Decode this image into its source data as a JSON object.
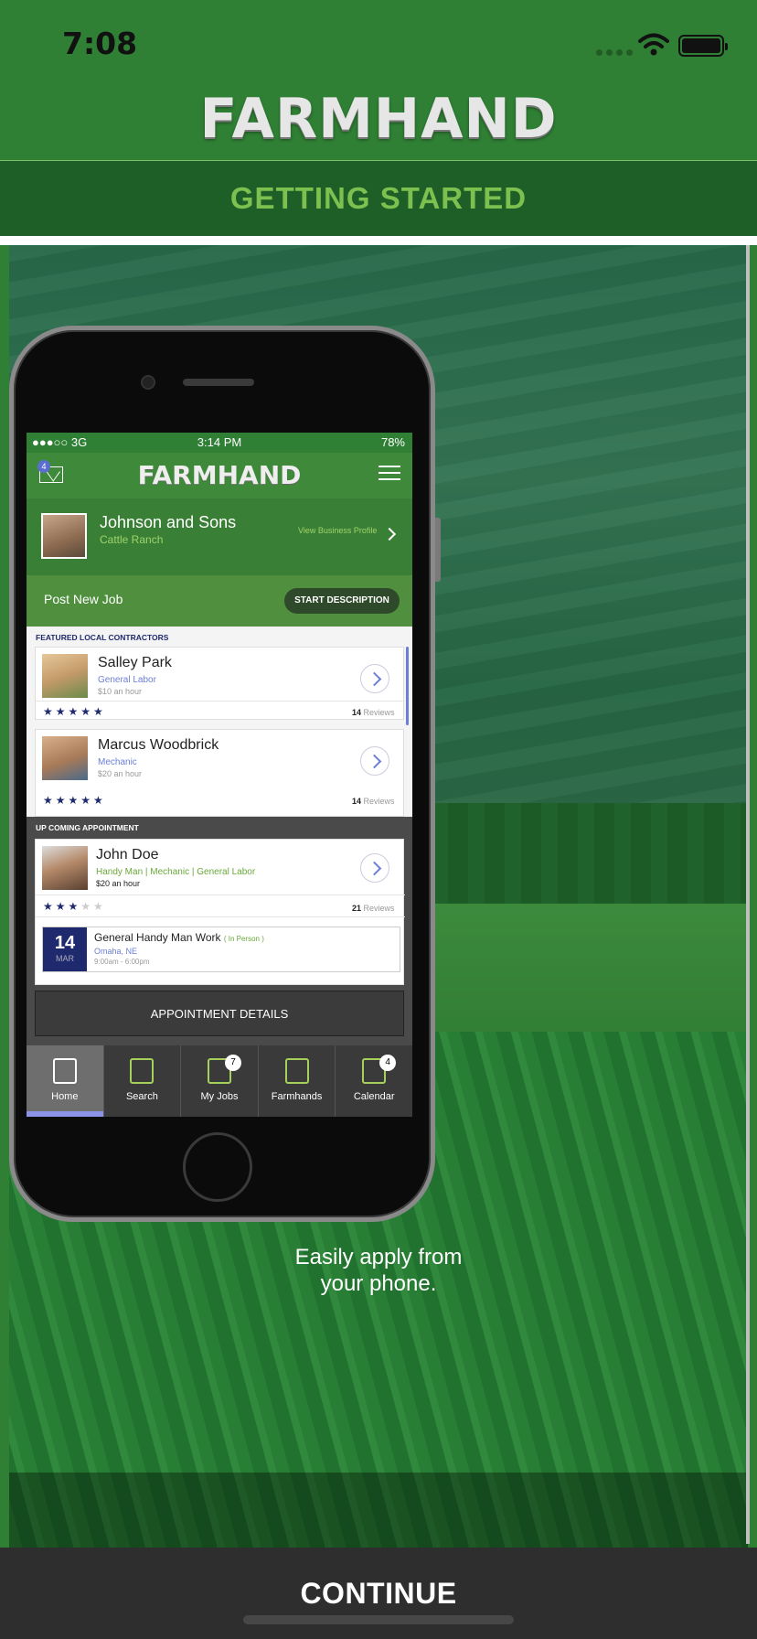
{
  "status_bar": {
    "time": "7:08"
  },
  "header": {
    "logo": "FARMHAND",
    "subtitle": "GETTING STARTED"
  },
  "slide": {
    "caption_line1": "Easily apply from",
    "caption_line2": "your phone."
  },
  "continue_label": "CONTINUE",
  "mockup": {
    "status": {
      "carrier": "●●●○○ 3G",
      "time": "3:14 PM",
      "battery": "78%"
    },
    "mail_badge": "4",
    "logo": "FARMHAND",
    "profile": {
      "name": "Johnson and Sons",
      "type": "Cattle Ranch",
      "view_link": "View Business Profile"
    },
    "post_job": {
      "label": "Post New Job",
      "button": "START DESCRIPTION"
    },
    "featured": {
      "heading": "FEATURED LOCAL CONTRACTORS",
      "contractors": [
        {
          "name": "Salley Park",
          "role": "General Labor",
          "rate": "$10 an hour",
          "stars": "★★★★★",
          "reviews_count": "14",
          "reviews_label": "Reviews"
        },
        {
          "name": "Marcus Woodbrick",
          "role": "Mechanic",
          "rate": "$20 an hour",
          "stars": "★★★★★",
          "reviews_count": "14",
          "reviews_label": "Reviews"
        }
      ]
    },
    "upcoming": {
      "heading": "UP COMING APPOINTMENT",
      "name": "John Doe",
      "roles": "Handy Man | Mechanic | General Labor",
      "rate": "$20 an hour",
      "stars_filled": "★★★",
      "stars_empty": "★★",
      "reviews_count": "21",
      "reviews_label": "Reviews",
      "date_day": "14",
      "date_month": "MAR",
      "job_title": "General Handy Man Work",
      "job_mode": "( In Person )",
      "location": "Omaha, NE",
      "hours": "9:00am - 6:00pm",
      "details_button": "APPOINTMENT DETAILS"
    },
    "tabs": [
      {
        "label": "Home"
      },
      {
        "label": "Search"
      },
      {
        "label": "My Jobs",
        "badge": "7"
      },
      {
        "label": "Farmhands"
      },
      {
        "label": "Calendar",
        "badge": "4"
      }
    ]
  },
  "colors": {
    "brand_green": "#2f7f34",
    "accent_green": "#7cc04f",
    "navy": "#1f2a6e",
    "dark_bar": "#2e2e2e"
  }
}
